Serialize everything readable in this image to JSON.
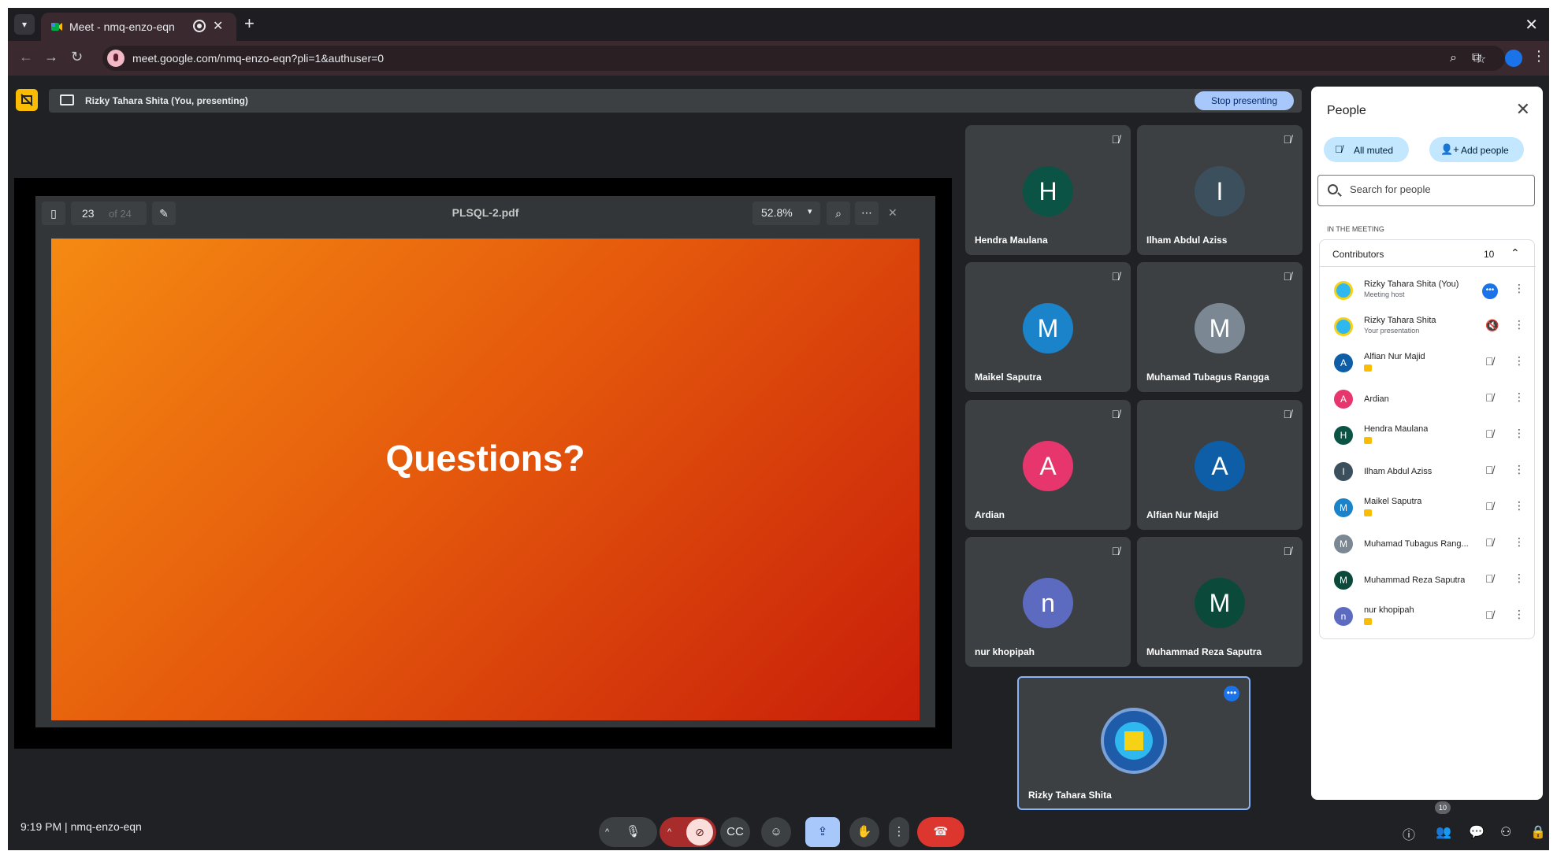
{
  "browser": {
    "tab_title": "Meet - nmq-enzo-eqn",
    "url": "meet.google.com/nmq-enzo-eqn?pli=1&authuser=0"
  },
  "presenting": {
    "text": "Rizky Tahara Shita (You, presenting)",
    "stop_label": "Stop presenting"
  },
  "pdf": {
    "page": "23",
    "page_total": "of 24",
    "title": "PLSQL-2.pdf",
    "zoom": "52.8%",
    "slide_text": "Questions?"
  },
  "tiles": [
    {
      "initial": "H",
      "name": "Hendra Maulana",
      "color": "#0b5344"
    },
    {
      "initial": "I",
      "name": "Ilham Abdul Aziss",
      "color": "#3c4f5c"
    },
    {
      "initial": "M",
      "name": "Maikel Saputra",
      "color": "#1a83c9"
    },
    {
      "initial": "M",
      "name": "Muhamad Tubagus Rangga",
      "color": "#7b8894"
    },
    {
      "initial": "A",
      "name": "Ardian",
      "color": "#e7366d"
    },
    {
      "initial": "A",
      "name": "Alfian Nur Majid",
      "color": "#0d5ea6"
    },
    {
      "initial": "n",
      "name": "nur khopipah",
      "color": "#5c6bc0"
    },
    {
      "initial": "M",
      "name": "Muhammad Reza Saputra",
      "color": "#0b4a3a"
    }
  ],
  "self_tile": {
    "name": "Rizky Tahara Shita"
  },
  "people": {
    "title": "People",
    "all_muted": "All muted",
    "add_people": "Add people",
    "search_placeholder": "Search for people",
    "section_label": "IN THE MEETING",
    "group_label": "Contributors",
    "count": "10",
    "list": [
      {
        "name": "Rizky Tahara Shita (You)",
        "sub": "Meeting host",
        "initial": "",
        "color": "#1e5ba8"
      },
      {
        "name": "Rizky Tahara Shita",
        "sub": "Your presentation",
        "initial": "",
        "color": "#1e5ba8"
      },
      {
        "name": "Alfian Nur Majid",
        "sub": "",
        "initial": "A",
        "color": "#0d5ea6"
      },
      {
        "name": "Ardian",
        "sub": "",
        "initial": "A",
        "color": "#e7366d"
      },
      {
        "name": "Hendra Maulana",
        "sub": "",
        "initial": "H",
        "color": "#0b5344"
      },
      {
        "name": "Ilham Abdul Aziss",
        "sub": "",
        "initial": "I",
        "color": "#3c4f5c"
      },
      {
        "name": "Maikel Saputra",
        "sub": "",
        "initial": "M",
        "color": "#1a83c9"
      },
      {
        "name": "Muhamad Tubagus Rang...",
        "sub": "",
        "initial": "M",
        "color": "#7b8894"
      },
      {
        "name": "Muhammad Reza Saputra",
        "sub": "",
        "initial": "M",
        "color": "#0b4a3a"
      },
      {
        "name": "nur khopipah",
        "sub": "",
        "initial": "n",
        "color": "#5c6bc0"
      }
    ]
  },
  "bottom": {
    "time": "9:19 PM",
    "meeting_code": "nmq-enzo-eqn",
    "people_badge": "10"
  }
}
